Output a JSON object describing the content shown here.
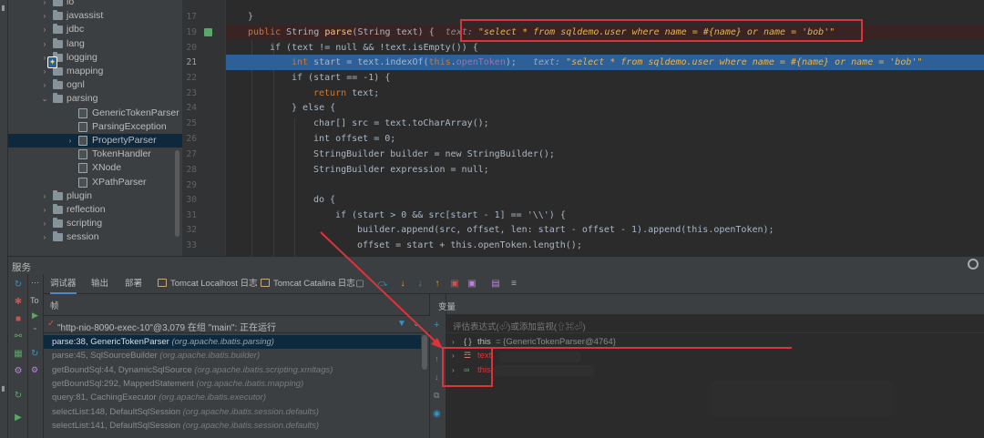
{
  "project_tree": {
    "items": [
      {
        "label": "io",
        "kind": "folder",
        "arrow": "›",
        "indent": 60
      },
      {
        "label": "javassist",
        "kind": "folder",
        "arrow": "›",
        "indent": 60
      },
      {
        "label": "jdbc",
        "kind": "folder",
        "arrow": "›",
        "indent": 60
      },
      {
        "label": "lang",
        "kind": "folder",
        "arrow": "›",
        "indent": 60
      },
      {
        "label": "logging",
        "kind": "folder",
        "arrow": "›",
        "indent": 60
      },
      {
        "label": "mapping",
        "kind": "folder",
        "arrow": "›",
        "indent": 60
      },
      {
        "label": "ognl",
        "kind": "folder",
        "arrow": "›",
        "indent": 60
      },
      {
        "label": "parsing",
        "kind": "folder",
        "arrow": "⌄",
        "indent": 60
      },
      {
        "label": "GenericTokenParser",
        "kind": "class",
        "arrow": "",
        "indent": 88
      },
      {
        "label": "ParsingException",
        "kind": "class",
        "arrow": "",
        "indent": 88
      },
      {
        "label": "PropertyParser",
        "kind": "class",
        "arrow": "›",
        "indent": 88,
        "selected": true
      },
      {
        "label": "TokenHandler",
        "kind": "class",
        "arrow": "",
        "indent": 88
      },
      {
        "label": "XNode",
        "kind": "class",
        "arrow": "",
        "indent": 88
      },
      {
        "label": "XPathParser",
        "kind": "class",
        "arrow": "",
        "indent": 88
      },
      {
        "label": "plugin",
        "kind": "folder",
        "arrow": "›",
        "indent": 60
      },
      {
        "label": "reflection",
        "kind": "folder",
        "arrow": "›",
        "indent": 60
      },
      {
        "label": "scripting",
        "kind": "folder",
        "arrow": "›",
        "indent": 60
      },
      {
        "label": "session",
        "kind": "folder",
        "arrow": "›",
        "indent": 60
      }
    ]
  },
  "editor": {
    "line_numbers": [
      "17",
      "19",
      "20",
      "21",
      "22",
      "23",
      "24",
      "25",
      "26",
      "27",
      "28",
      "29",
      "30",
      "31",
      "32",
      "33"
    ],
    "current_line": "21",
    "lines": {
      "l17": "}",
      "l19_kw1": "public ",
      "l19_type": "String ",
      "l19_fn": "parse",
      "l19_rest": "(String text) {",
      "l19_hint_name": "text: ",
      "l19_hint_val": "\"select * from sqldemo.user where name = #{name} or name = 'bob'\"",
      "l20": "if (text != null && !text.isEmpty()) {",
      "l21_type": "int ",
      "l21_var": "start",
      "l21_a": " = text.indexOf(",
      "l21_this": "this",
      "l21_b": ".",
      "l21_field": "openToken",
      "l21_c": ");",
      "l21_hint_name": "text: ",
      "l21_hint_val": "\"select * from sqldemo.user where name = #{name} or name = 'bob'\"",
      "l22": "if (start == -1) {",
      "l23_kw": "return ",
      "l23_rest": "text;",
      "l24": "} else {",
      "l25": "char[] src = text.toCharArray();",
      "l26": "int offset = 0;",
      "l27": "StringBuilder builder = new StringBuilder();",
      "l28": "StringBuilder expression = null;",
      "l30": "do {",
      "l31": "if (start > 0 && src[start - 1] == '\\\\') {",
      "l32": "builder.append(src, offset, len: start - offset - 1).append(this.openToken);",
      "l33": "offset = start + this.openToken.length();"
    }
  },
  "services": {
    "title": "服务",
    "tree_label": "To"
  },
  "debug_tabs": [
    {
      "label": "调试器",
      "active": true
    },
    {
      "label": "输出"
    },
    {
      "label": "部署"
    },
    {
      "label": "Tomcat Localhost 日志",
      "icon": true
    },
    {
      "label": "Tomcat Catalina 日志",
      "icon": true
    }
  ],
  "frames": {
    "title": "帧",
    "thread": "\"http-nio-8090-exec-10\"@3,079 在组 \"main\": 正在运行",
    "items": [
      {
        "method": "parse:38, GenericTokenParser ",
        "cls": "(org.apache.ibatis.parsing)",
        "selected": true
      },
      {
        "method": "parse:45, SqlSourceBuilder ",
        "cls": "(org.apache.ibatis.builder)"
      },
      {
        "method": "getBoundSql:44, DynamicSqlSource ",
        "cls": "(org.apache.ibatis.scripting.xmltags)"
      },
      {
        "method": "getBoundSql:292, MappedStatement ",
        "cls": "(org.apache.ibatis.mapping)"
      },
      {
        "method": "query:81, CachingExecutor ",
        "cls": "(org.apache.ibatis.executor)"
      },
      {
        "method": "selectList:148, DefaultSqlSession ",
        "cls": "(org.apache.ibatis.session.defaults)"
      },
      {
        "method": "selectList:141, DefaultSqlSession ",
        "cls": "(org.apache.ibatis.session.defaults)"
      }
    ]
  },
  "variables": {
    "title": "变量",
    "watch_placeholder": "评估表达式(⏎)或添加监视(⇧⌘⏎)",
    "items": [
      {
        "name": "this",
        "value": " = {GenericTokenParser@4764}"
      },
      {
        "name": "text",
        "value": ""
      },
      {
        "name": "this.",
        "value": ""
      }
    ]
  },
  "colors": {
    "keyword": "#cc7832",
    "method": "#ffc66d",
    "field": "#9876aa",
    "highlight": "#2d6099",
    "annotation": "#e0323a"
  }
}
